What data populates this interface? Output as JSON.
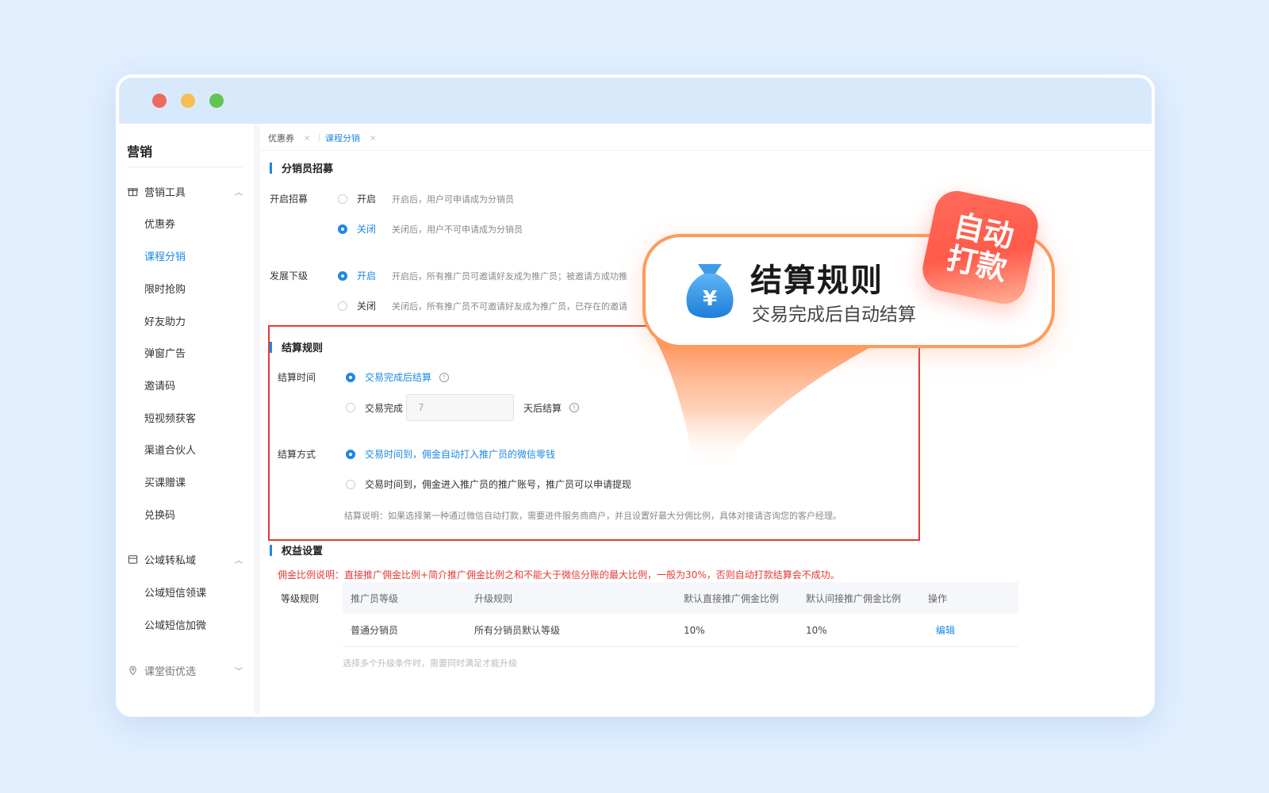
{
  "sidebar": {
    "title": "营销",
    "groups": [
      {
        "label": "营销工具",
        "items": [
          "优惠券",
          "课程分销",
          "限时抢购",
          "好友助力",
          "弹窗广告",
          "邀请码",
          "短视频获客",
          "渠道合伙人",
          "买课赠课",
          "兑换码"
        ]
      },
      {
        "label": "公域转私域",
        "items": [
          "公域短信领课",
          "公域短信加微"
        ]
      },
      {
        "label": "课堂街优选",
        "items": []
      }
    ],
    "active_item": "课程分销"
  },
  "tabs": [
    {
      "label": "优惠券",
      "close": "×"
    },
    {
      "label": "课程分销",
      "close": "×"
    }
  ],
  "recruit": {
    "heading": "分销员招募",
    "label": "开启招募",
    "options": [
      {
        "label": "开启",
        "desc": "开启后，用户可申请成为分销员",
        "selected": false
      },
      {
        "label": "关闭",
        "desc": "关闭后，用户不可申请成为分销员",
        "selected": true
      }
    ]
  },
  "subordinate": {
    "label": "发展下级",
    "options": [
      {
        "label": "开启",
        "desc": "开启后，所有推广员可邀请好友成为推广员；被邀请方成功推",
        "selected": true
      },
      {
        "label": "关闭",
        "desc": "关闭后，所有推广员不可邀请好友成为推广员，已存在的邀请",
        "selected": false
      }
    ]
  },
  "settlement": {
    "heading": "结算规则",
    "time_label": "结算时间",
    "time_option1": "交易完成后结算",
    "time_option2_prefix": "交易完成",
    "days_placeholder": "7",
    "time_option2_suffix": "天后结算",
    "info_glyph": "!",
    "method_label": "结算方式",
    "method_option1": "交易时间到，佣金自动打入推广员的微信零钱",
    "method_option2": "交易时间到，佣金进入推广员的推广账号，推广员可以申请提现",
    "note": "结算说明：如果选择第一种通过微信自动打款，需要进件服务商商户，并且设置好最大分佣比例，具体对接请咨询您的客户经理。"
  },
  "rights": {
    "heading": "权益设置",
    "warning": "佣金比例说明：直接推广佣金比例+简介推广佣金比例之和不能大于微信分账的最大比例，一般为30%，否则自动打款结算会不成功。",
    "level_label": "等级规则",
    "columns": [
      "推广员等级",
      "升级规则",
      "默认直接推广佣金比例",
      "默认间接推广佣金比例",
      "操作"
    ],
    "rows": [
      [
        "普通分销员",
        "所有分销员默认等级",
        "10%",
        "10%",
        "编辑"
      ]
    ],
    "footnote": "选择多个升级条件时，需要同时满足才能升级"
  },
  "callout": {
    "title": "结算规则",
    "subtitle": "交易完成后自动结算",
    "badge_line1": "自动",
    "badge_line2": "打款",
    "icon_glyph": "¥"
  },
  "colors": {
    "accent": "#1e88e5",
    "warning": "#e53935",
    "callout_border": "#ff9a5c",
    "badge": "#ff5a4a"
  }
}
